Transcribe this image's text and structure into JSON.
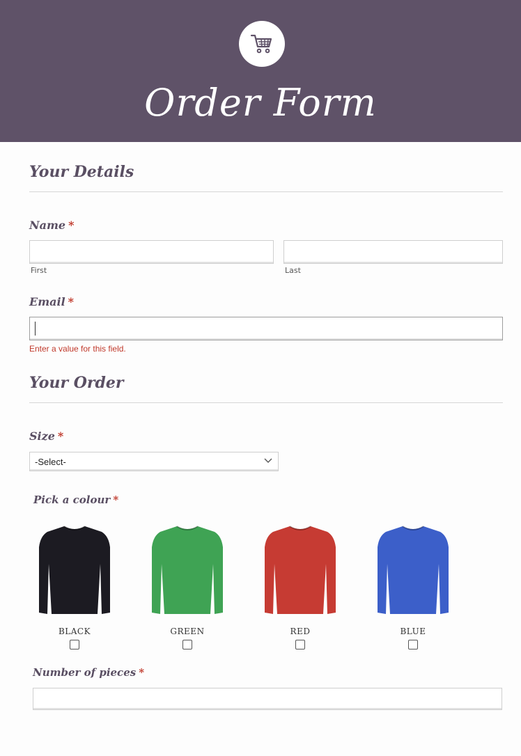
{
  "header": {
    "icon": "shopping-cart-icon",
    "title": "Order Form",
    "background": "#5f5268"
  },
  "sections": {
    "details_title": "Your Details",
    "order_title": "Your Order"
  },
  "name_field": {
    "label": "Name",
    "required_mark": "*",
    "first_value": "",
    "first_sublabel": "First",
    "last_value": "",
    "last_sublabel": "Last"
  },
  "email_field": {
    "label": "Email",
    "required_mark": "*",
    "value": "",
    "error": "Enter a value for this field."
  },
  "size_field": {
    "label": "Size",
    "required_mark": "*",
    "selected": "-Select-"
  },
  "colour_field": {
    "label": "Pick a colour",
    "required_mark": "*",
    "options": [
      {
        "label": "BLACK",
        "color": "#1c1b22",
        "checked": false
      },
      {
        "label": "GREEN",
        "color": "#3fa354",
        "checked": false
      },
      {
        "label": "RED",
        "color": "#c63b33",
        "checked": false
      },
      {
        "label": "BLUE",
        "color": "#3c5fc9",
        "checked": false
      }
    ]
  },
  "pieces_field": {
    "label": "Number of pieces",
    "required_mark": "*",
    "value": ""
  },
  "colors": {
    "accent": "#5a4f63",
    "error": "#c0392b"
  }
}
